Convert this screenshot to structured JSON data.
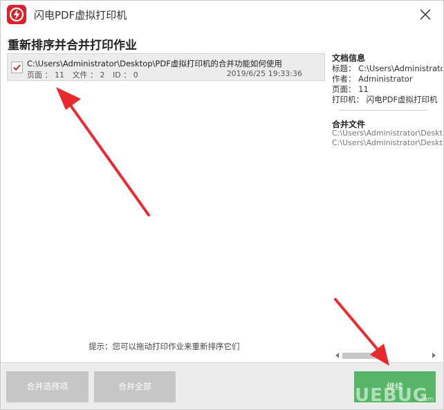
{
  "window": {
    "title": "闪电PDF虚拟打印机"
  },
  "heading": "重新排序并合并打印作业",
  "jobs": [
    {
      "path": "C:\\Users\\Administrator\\Desktop\\PDF虚拟打印机的合并功能如何使用",
      "pages": "页面 ： 11",
      "files": "文件 ： 2",
      "id": "ID ： 0",
      "date": "2019/6/25 19:33:36",
      "checked": true
    }
  ],
  "info": {
    "doc_title": "文档信息",
    "title_row": "标题： C:\\Users\\Administrator",
    "author_row": "作者： Administrator",
    "pages_row": "页面： 11",
    "printer_row": "打印机： 闪电PDF虚拟打印机",
    "merge_title": "合并文件",
    "merge_files": [
      "C:\\Users\\Administrator\\Deskt",
      "C:\\Users\\Administrator\\Deskt"
    ]
  },
  "hint": "提示：您可以拖动打印作业来重新排序它们",
  "buttons": {
    "merge_selected": "合并选择项",
    "merge_all": "合并全部",
    "continue": "继续"
  },
  "watermark": {
    "text": "UEBUG",
    "sub": ".com"
  },
  "colors": {
    "accent_red": "#d7232a",
    "continue_green": "#56b567",
    "disabled_gray": "#c6c6c6",
    "arrow_red": "#e8292d"
  }
}
